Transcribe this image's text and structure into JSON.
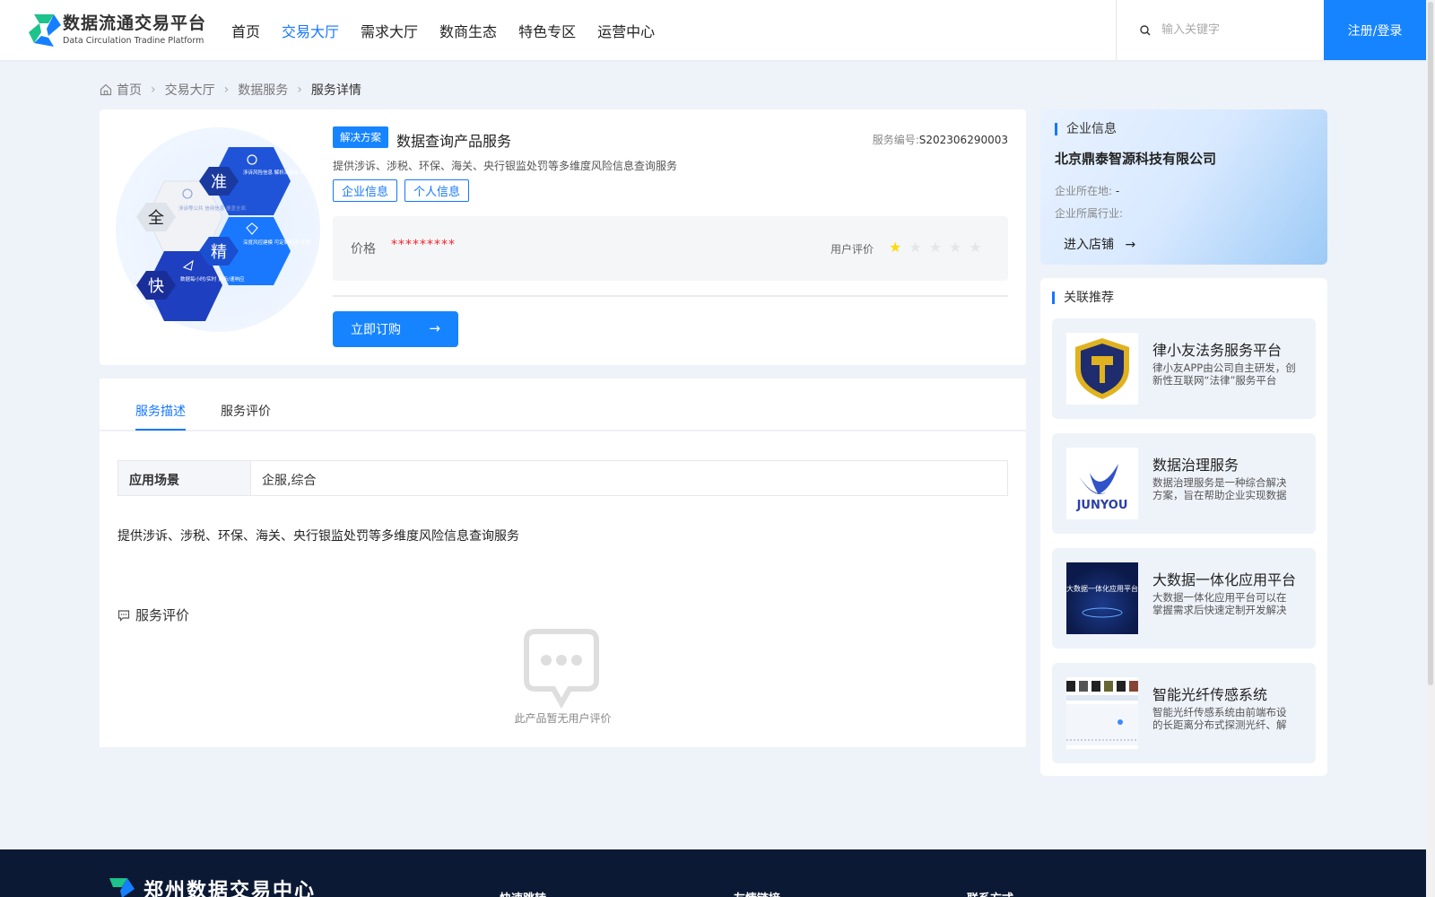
{
  "header": {
    "logo_cn": "数据流通交易平台",
    "logo_en": "Data Circulation Tradine Platform",
    "nav": [
      "首页",
      "交易大厅",
      "需求大厅",
      "数商生态",
      "特色专区",
      "运营中心"
    ],
    "active_nav_index": 1,
    "search_placeholder": "输入关键字",
    "login_label": "注册/登录"
  },
  "breadcrumb": [
    "首页",
    "交易大厅",
    "数据服务",
    "服务详情"
  ],
  "product": {
    "image_chars": [
      "准",
      "全",
      "精",
      "快"
    ],
    "image_texts": [
      "涉诉风险信息 解析准确率 超99%",
      "涉诉等公共 信用信息 覆盖全面",
      "深度风控建模 可定制精细 字段",
      "数据每小时/实时 更新/速响应"
    ],
    "tag": "解决方案",
    "title": "数据查询产品服务",
    "service_no_label": "服务编号:",
    "service_no": "S202306290003",
    "desc": "提供涉诉、涉税、环保、海关、央行银监处罚等多维度风险信息查询服务",
    "buttons": [
      "企业信息",
      "个人信息"
    ],
    "price_label": "价格",
    "price": "*********",
    "rating_label": "用户评价",
    "rating": 1,
    "rating_max": 5,
    "buy_label": "立即订购"
  },
  "tabs": [
    "服务描述",
    "服务评价"
  ],
  "active_tab_index": 0,
  "detail": {
    "scene_key": "应用场景",
    "scene_value": "企服,综合",
    "description": "提供涉诉、涉税、环保、海关、央行银监处罚等多维度风险信息查询服务"
  },
  "review": {
    "title": "服务评价",
    "empty_text": "此产品暂无用户评价"
  },
  "company": {
    "section_title": "企业信息",
    "name": "北京鼎泰智源科技有限公司",
    "location_label": "企业所在地:",
    "location": "-",
    "industry_label": "企业所属行业:",
    "industry": "",
    "enter_shop": "进入店铺"
  },
  "related": {
    "section_title": "关联推荐",
    "items": [
      {
        "title": "律小友法务服务平台",
        "desc": "律小友APP由公司自主研发，创新性互联网“法律”服务平台",
        "thumb": "shield-gavel"
      },
      {
        "title": "数据治理服务",
        "desc": "数据治理服务是一种综合解决方案，旨在帮助企业实现数据治理",
        "thumb": "junyou",
        "thumb_text": "JUNYOU"
      },
      {
        "title": "大数据一体化应用平台",
        "desc": "大数据一体化应用平台可以在掌握需求后快速定制开发解决方案",
        "thumb": "bigdata",
        "thumb_text": "大数据一体化应用平台"
      },
      {
        "title": "智能光纤传感系统",
        "desc": "智能光纤传感系统由前端布设的长距离分布式探测光纤、解调主机组成",
        "thumb": "fiber"
      }
    ]
  },
  "footer": {
    "name": "郑州数据交易中心",
    "cols": [
      "快速跳转",
      "友情链接",
      "联系方式"
    ]
  },
  "colors": {
    "primary": "#1684ff",
    "price": "#f5222d",
    "star": "#fadb14",
    "footer": "#0c1934"
  }
}
